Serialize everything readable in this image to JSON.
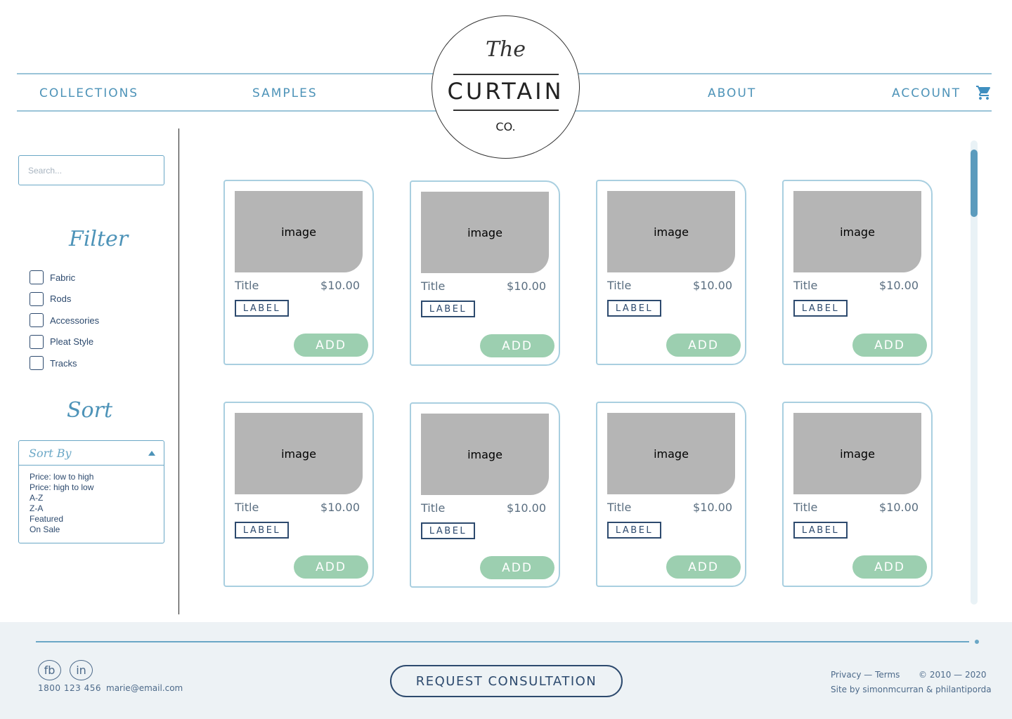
{
  "nav": {
    "collections": "COLLECTIONS",
    "samples": "SAMPLES",
    "about": "ABOUT",
    "account": "ACCOUNT",
    "cart_icon": "shopping-cart-icon"
  },
  "logo": {
    "the": "The",
    "name": "CURTAIN",
    "suffix": "CO."
  },
  "sidebar": {
    "search_placeholder": "Search...",
    "filter_heading": "Filter",
    "filters": [
      {
        "label": "Fabric",
        "checked": false
      },
      {
        "label": "Rods",
        "checked": false
      },
      {
        "label": "Accessories",
        "checked": false
      },
      {
        "label": "Pleat Style",
        "checked": false
      },
      {
        "label": "Tracks",
        "checked": false
      }
    ],
    "sort_heading": "Sort",
    "sort_by": "Sort By",
    "sort_options": [
      "Price: low to high",
      "Price: high to low",
      "A-Z",
      "Z-A",
      "Featured",
      "On Sale"
    ]
  },
  "products": [
    {
      "image": "image",
      "title": "Title",
      "price": "$10.00",
      "label": "LABEL",
      "add": "ADD"
    },
    {
      "image": "image",
      "title": "Title",
      "price": "$10.00",
      "label": "LABEL",
      "add": "ADD"
    },
    {
      "image": "image",
      "title": "Title",
      "price": "$10.00",
      "label": "LABEL",
      "add": "ADD"
    },
    {
      "image": "image",
      "title": "Title",
      "price": "$10.00",
      "label": "LABEL",
      "add": "ADD"
    },
    {
      "image": "image",
      "title": "Title",
      "price": "$10.00",
      "label": "LABEL",
      "add": "ADD"
    },
    {
      "image": "image",
      "title": "Title",
      "price": "$10.00",
      "label": "LABEL",
      "add": "ADD"
    },
    {
      "image": "image",
      "title": "Title",
      "price": "$10.00",
      "label": "LABEL",
      "add": "ADD"
    },
    {
      "image": "image",
      "title": "Title",
      "price": "$10.00",
      "label": "LABEL",
      "add": "ADD"
    }
  ],
  "footer": {
    "facebook": "fb",
    "linkedin": "in",
    "phone": "1800 123 456",
    "email": "marie@email.com",
    "consultation": "REQUEST CONSULTATION",
    "legal": "Privacy — Terms",
    "copyright": "© 2010 — 2020",
    "credit": "Site by simonmcurran & philantiporda"
  },
  "colors": {
    "accent": "#4d93b8",
    "navy": "#2d4a6e",
    "add_button": "#9ccfb0",
    "card_border": "#a9cfe0",
    "image_placeholder": "#b5b5b5"
  }
}
